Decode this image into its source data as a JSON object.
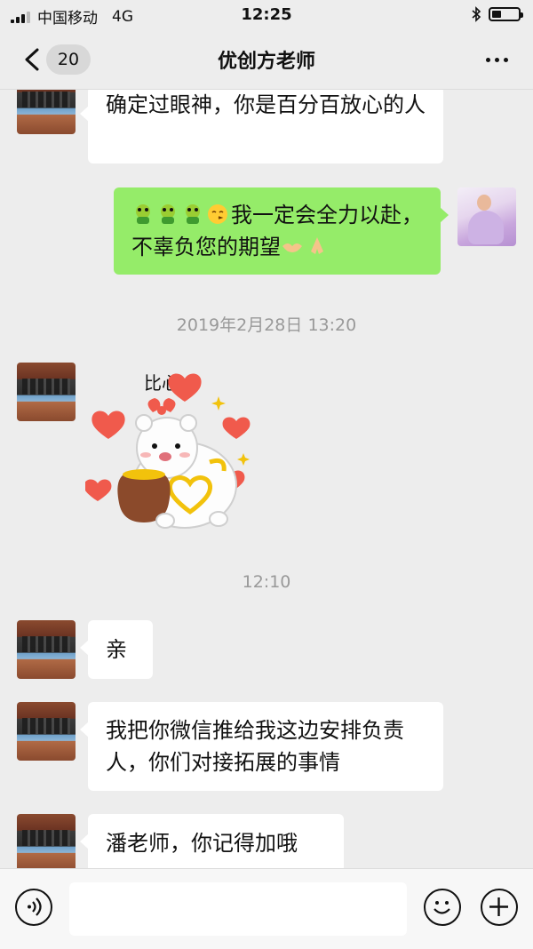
{
  "status_bar": {
    "carrier": "中国移动",
    "network": "4G",
    "time": "12:25",
    "battery_level": 0.35
  },
  "header": {
    "unread_count": "20",
    "title": "优创方老师"
  },
  "messages": [
    {
      "side": "in",
      "text": "确定过眼神，你是百分百放心的人"
    },
    {
      "side": "out",
      "emoji_icons": [
        "frog-icon",
        "frog-icon",
        "frog-icon",
        "kiss-face-icon"
      ],
      "text": "我一定会全力以赴，不辜负您的期望",
      "trailing_icons": [
        "handshake-icon",
        "pray-hands-icon"
      ]
    },
    {
      "type": "timestamp",
      "text": "2019年2月28日 13:20"
    },
    {
      "side": "in",
      "type": "sticker",
      "sticker_text": "比心"
    },
    {
      "type": "timestamp",
      "text": "12:10"
    },
    {
      "side": "in",
      "text": "亲"
    },
    {
      "side": "in",
      "text": "我把你微信推给我这边安排负责人，你们对接拓展的事情"
    },
    {
      "side": "in",
      "text": "潘老师，你记得加哦"
    }
  ],
  "input_bar": {
    "placeholder": "",
    "left_icon": "voice-icon",
    "right_icons": [
      "emoji-icon",
      "plus-icon"
    ]
  },
  "colors": {
    "background": "#ededed",
    "outgoing_bubble": "#95ec69",
    "incoming_bubble": "#ffffff",
    "heart": "#f05a4c"
  }
}
